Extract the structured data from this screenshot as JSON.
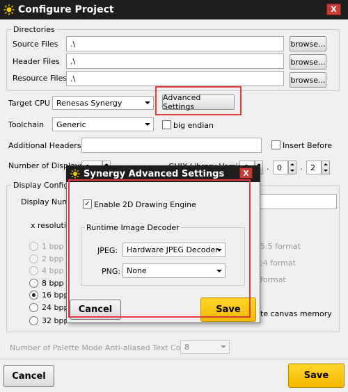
{
  "window": {
    "title": "Configure Project",
    "close_label": "X"
  },
  "directories": {
    "legend": "Directories",
    "rows": [
      {
        "label": "Source Files",
        "value": ".\\",
        "browse": "browse..."
      },
      {
        "label": "Header Files",
        "value": ".\\",
        "browse": "browse..."
      },
      {
        "label": "Resource Files",
        "value": ".\\",
        "browse": "browse..."
      }
    ]
  },
  "target_cpu": {
    "label": "Target CPU",
    "value": "Renesas Synergy",
    "advanced_button": "Advanced Settings"
  },
  "toolchain": {
    "label": "Toolchain",
    "value": "Generic",
    "big_endian_label": "big endian",
    "big_endian_checked": false
  },
  "additional_headers": {
    "label": "Additional Headers",
    "value": "",
    "insert_before_label": "Insert Before",
    "insert_before_checked": false
  },
  "number_of_displays": {
    "label": "Number of Displays",
    "value": "1"
  },
  "guix_version": {
    "label": "GUIX Library Version",
    "major": "6",
    "minor": "0",
    "patch": "2",
    "sep": "."
  },
  "display_config": {
    "legend": "Display Configuration",
    "display_number_label": "Display Number",
    "x_resolution_label": "x resolution",
    "bpp_options": [
      {
        "label": "1 bpp",
        "enabled": false,
        "checked": false
      },
      {
        "label": "2 bpp",
        "enabled": false,
        "checked": false
      },
      {
        "label": "4 bpp",
        "enabled": false,
        "checked": false
      },
      {
        "label": "8 bpp",
        "enabled": true,
        "checked": false
      },
      {
        "label": "16 bpp",
        "enabled": true,
        "checked": true
      },
      {
        "label": "24 bpp",
        "enabled": true,
        "checked": false
      },
      {
        "label": "32 bpp",
        "enabled": true,
        "checked": false
      }
    ],
    "format_565": "5:5 format",
    "format_4444": ":4 format",
    "format_other": "format",
    "canvas_memory_label": "te canvas memory"
  },
  "palette": {
    "label": "Number of Palette Mode Anti-aliased Text Colors:",
    "value": "8"
  },
  "footer": {
    "cancel": "Cancel",
    "save": "Save"
  },
  "overlay_dialog": {
    "title": "Synergy Advanced Settings",
    "close_label": "X",
    "enable_2d_label": "Enable 2D Drawing Engine",
    "enable_2d_checked": true,
    "decoder_legend": "Runtime Image Decoder",
    "jpeg_label": "JPEG:",
    "jpeg_value": "Hardware JPEG Decoder",
    "png_label": "PNG:",
    "png_value": "None",
    "cancel": "Cancel",
    "save": "Save"
  },
  "colors": {
    "title_bar": "#1e1e1e",
    "close_button": "#c43c36",
    "save_button": "#f5b800",
    "highlight_red": "#e23b3b"
  }
}
